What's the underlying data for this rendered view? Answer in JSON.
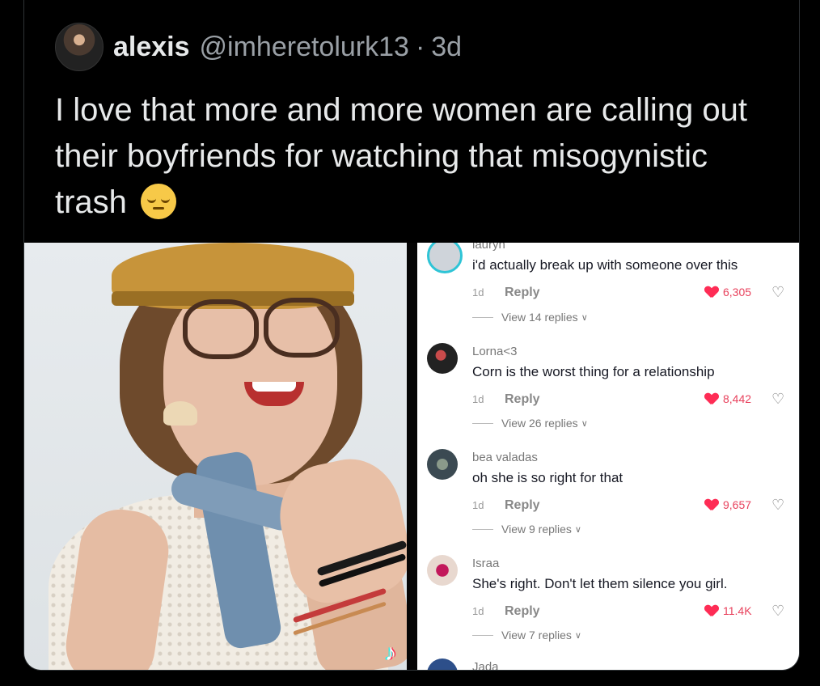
{
  "tweet": {
    "name": "alexis",
    "handle": "@imheretolurk13",
    "separator": "·",
    "time": "3d",
    "text": "I love that more and more women are calling out their boyfriends for watching that misogynistic trash",
    "emoji": "pensive-face-emoji"
  },
  "media": {
    "watermark_icon": "tiktok-icon",
    "comments": [
      {
        "user": "lauryn",
        "text": "i'd actually break up with someone over this",
        "age": "1d",
        "reply": "Reply",
        "likes": "6,305",
        "view_replies": "View 14 replies"
      },
      {
        "user": "Lorna<3",
        "text": "Corn is the worst thing for a relationship",
        "age": "1d",
        "reply": "Reply",
        "likes": "8,442",
        "view_replies": "View 26 replies"
      },
      {
        "user": "bea valadas",
        "text": "oh she is so right for that",
        "age": "1d",
        "reply": "Reply",
        "likes": "9,657",
        "view_replies": "View 9 replies"
      },
      {
        "user": "Israa",
        "text": "She's right. Don't let them silence you girl.",
        "age": "1d",
        "reply": "Reply",
        "likes": "11.4K",
        "view_replies": "View 7 replies"
      },
      {
        "user": "Jada"
      }
    ]
  },
  "colors": {
    "background": "#000000",
    "tweet_text": "#e7e9ea",
    "muted": "#9aa0a6",
    "like_red": "#fe2c55"
  }
}
